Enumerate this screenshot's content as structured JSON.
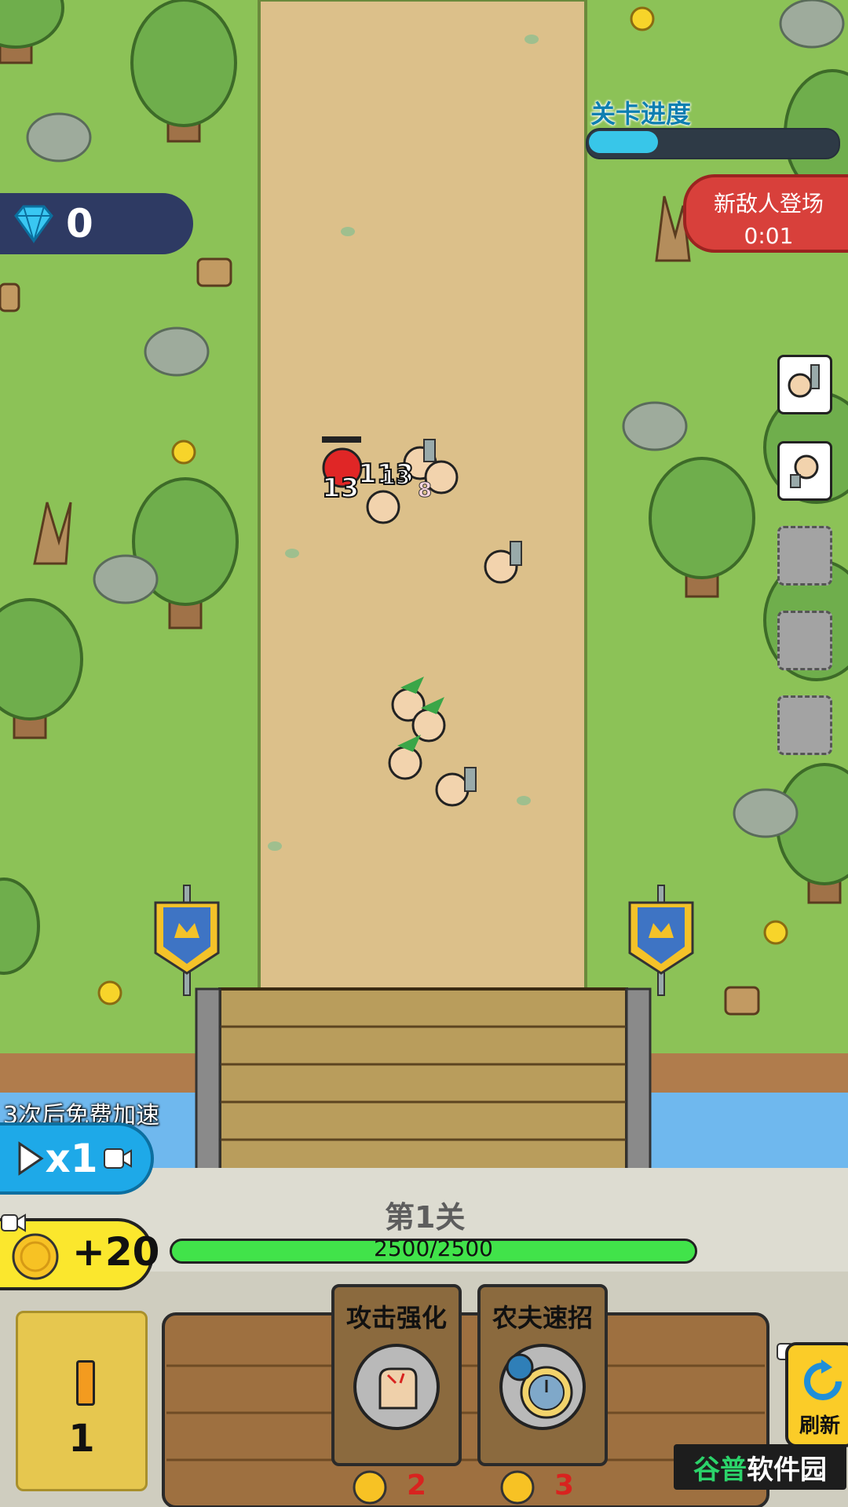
{
  "gems": {
    "count": "0"
  },
  "level_progress": {
    "label": "关卡进度",
    "fraction": 0.28
  },
  "new_enemy": {
    "label": "新敌人登场",
    "timer": "0:01"
  },
  "damage_numbers": [
    "13",
    "113",
    "13",
    "8"
  ],
  "unit_slots": [
    {
      "state": "filled",
      "unit": "farmer-pitchfork"
    },
    {
      "state": "filled",
      "unit": "farmer-shovel"
    },
    {
      "state": "empty"
    },
    {
      "state": "empty"
    },
    {
      "state": "empty"
    }
  ],
  "speed": {
    "hint": "3次后免费加速",
    "label": "x1"
  },
  "coin_bonus": {
    "label": "+20"
  },
  "castle": {
    "level_label": "第1关",
    "hp_text": "2500/2500",
    "hp_fraction": 1.0
  },
  "deck": {
    "count": "1"
  },
  "cards": [
    {
      "title": "攻击强化",
      "cost": "2",
      "icon": "fist-icon"
    },
    {
      "title": "农夫速招",
      "cost": "3",
      "icon": "stopwatch-icon"
    }
  ],
  "refresh": {
    "label": "刷新"
  },
  "watermark": {
    "text_accent": "谷普",
    "text_rest": "软件园"
  },
  "colors": {
    "grass": "#8cc257",
    "road": "#dcc08a",
    "water": "#6fb8ee",
    "wall": "#dddcd1",
    "progress": "#38c6e9",
    "hp": "#41e34a",
    "enemy_banner": "#d8403b"
  }
}
